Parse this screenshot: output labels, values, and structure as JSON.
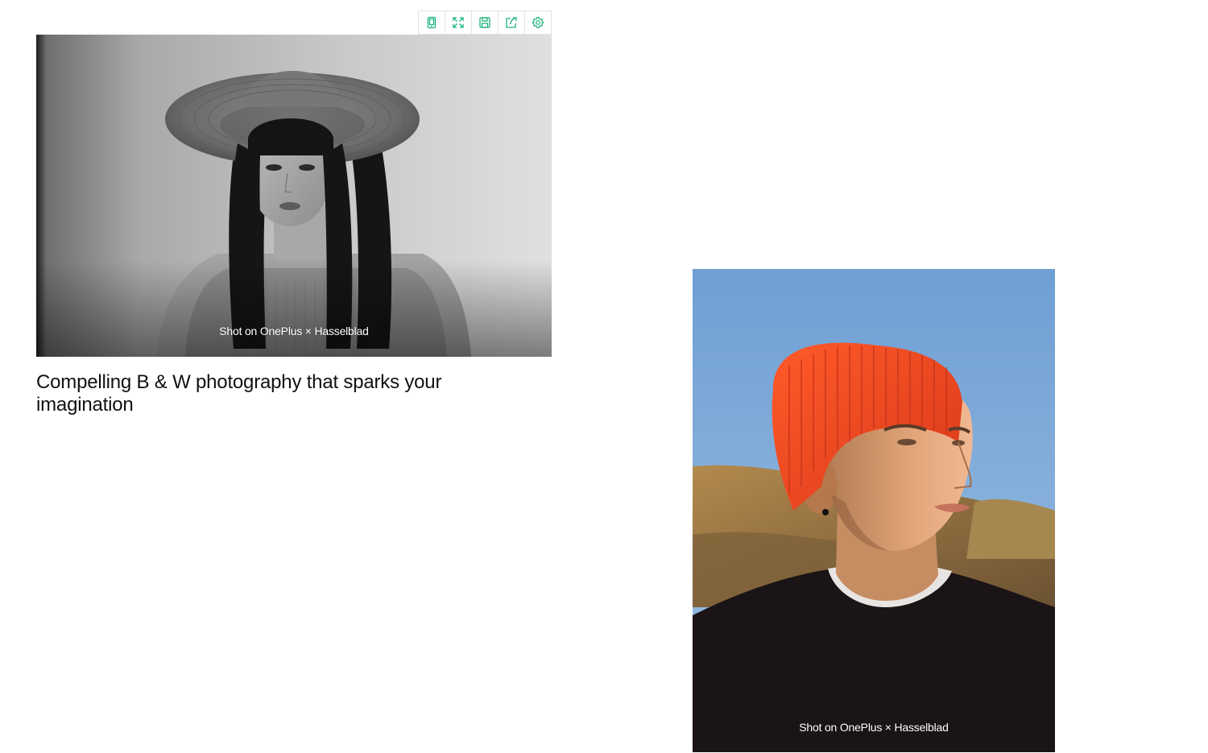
{
  "toolbar": {
    "accent_color": "#1db37a",
    "buttons": [
      {
        "name": "tablet-view",
        "icon": "tablet-icon"
      },
      {
        "name": "fullscreen",
        "icon": "expand-icon"
      },
      {
        "name": "save",
        "icon": "save-icon"
      },
      {
        "name": "share",
        "icon": "share-icon"
      },
      {
        "name": "settings",
        "icon": "gear-icon"
      }
    ]
  },
  "gallery": {
    "feature_1": {
      "credit": "Shot on OnePlus  ×  Hasselblad",
      "headline": "Compelling B & W photography that sparks your imagination",
      "style": "black-and-white portrait"
    },
    "feature_2": {
      "credit": "Shot on OnePlus  ×  Hasselblad",
      "style": "color portrait"
    }
  }
}
